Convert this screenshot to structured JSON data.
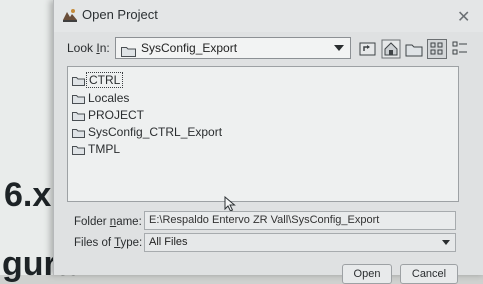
{
  "background": {
    "text_1": "6.x",
    "text_2": "gura"
  },
  "dialog": {
    "title": "Open Project",
    "close_glyph": "✕",
    "look_in": {
      "label_prefix": "Look ",
      "label_mnemonic": "I",
      "label_suffix": "n:",
      "value": "SysConfig_Export"
    },
    "toolbar": [
      "up-one-level-icon",
      "home-icon",
      "new-folder-icon",
      "list-view-icon",
      "details-view-icon"
    ],
    "files": [
      {
        "name": "CTRL",
        "selected": true
      },
      {
        "name": "Locales",
        "selected": false
      },
      {
        "name": "PROJECT",
        "selected": false
      },
      {
        "name": "SysConfig_CTRL_Export",
        "selected": false
      },
      {
        "name": "TMPL",
        "selected": false
      }
    ],
    "folder_name": {
      "label_prefix": "Folder ",
      "label_mnemonic": "n",
      "label_suffix": "ame:",
      "value": "E:\\Respaldo Entervo ZR Vall\\SysConfig_Export"
    },
    "files_of_type": {
      "label_prefix": "Files of ",
      "label_mnemonic": "T",
      "label_suffix": "ype:",
      "value": "All Files"
    },
    "buttons": {
      "open": "Open",
      "cancel": "Cancel"
    }
  }
}
